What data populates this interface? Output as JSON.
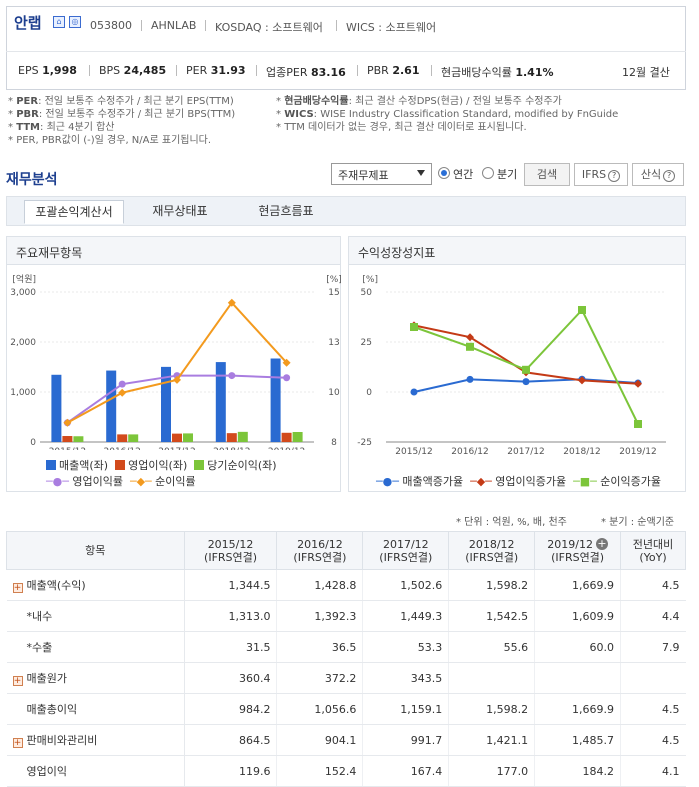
{
  "header": {
    "company_name": "안랩",
    "code": "053800",
    "english_name": "AHNLAB",
    "market": "KOSDAQ : 소프트웨어",
    "wics": "WICS : 소프트웨어",
    "stats": [
      {
        "label": "EPS",
        "value": "1,998"
      },
      {
        "label": "BPS",
        "value": "24,485"
      },
      {
        "label": "PER",
        "value": "31.93"
      },
      {
        "label": "업종PER",
        "value": "83.16"
      },
      {
        "label": "PBR",
        "value": "2.61"
      },
      {
        "label": "현금배당수익률",
        "value": "1.41%"
      }
    ],
    "fiscal": "12월 결산"
  },
  "notes": {
    "left": [
      {
        "key": "PER",
        "text": ": 전일 보통주 수정주가 / 최근 분기 EPS(TTM)"
      },
      {
        "key": "PBR",
        "text": ": 전일 보통주 수정주가 / 최근 분기 BPS(TTM)"
      },
      {
        "key": "TTM",
        "text": ": 최근 4분기 합산"
      },
      {
        "key": "",
        "text": "PER, PBR값이 (-)일 경우, N/A로 표기됩니다."
      }
    ],
    "right": [
      {
        "key": "현금배당수익률",
        "text": ": 최근 결산 수정DPS(현금) / 전일 보통주 수정주가"
      },
      {
        "key": "WICS",
        "text": ": WISE Industry Classification Standard, modified by FnGuide"
      },
      {
        "key": "",
        "text": "TTM 데이터가 없는 경우, 최근 결산 데이터로 표시됩니다."
      }
    ]
  },
  "section": {
    "title": "재무분석",
    "select_value": "주재무제표",
    "radio_annual": "연간",
    "radio_quarter": "분기",
    "search_button": "검색",
    "ifrs_button": "IFRS",
    "formula_button": "산식"
  },
  "tabs": [
    {
      "label": "포괄손익계산서",
      "active": true
    },
    {
      "label": "재무상태표",
      "active": false
    },
    {
      "label": "현금흐름표",
      "active": false
    }
  ],
  "chart_data": [
    {
      "type": "bar",
      "panel_title": "주요재무항목",
      "categories": [
        "2015/12",
        "2016/12",
        "2017/12",
        "2018/12",
        "2019/12"
      ],
      "y_left_label": "[억원]",
      "y_right_label": "[%]",
      "y_left_ticks": [
        "3,000",
        "2,000",
        "1,000",
        "0"
      ],
      "y_right_ticks": [
        "15",
        "13",
        "10",
        "8"
      ],
      "ylim_left": [
        0,
        3000
      ],
      "ylim_right": [
        8,
        15
      ],
      "series": [
        {
          "name": "매출액(좌)",
          "kind": "bar",
          "axis": "left",
          "color": "#2a6ad1",
          "values": [
            1344.5,
            1428.8,
            1502.6,
            1598.2,
            1669.9
          ]
        },
        {
          "name": "영업이익(좌)",
          "kind": "bar",
          "axis": "left",
          "color": "#d24a1c",
          "values": [
            119.6,
            152.4,
            167.4,
            177.0,
            184.2
          ]
        },
        {
          "name": "당기순이익(좌)",
          "kind": "bar",
          "axis": "left",
          "color": "#7cc53a",
          "values": [
            115.0,
            152.0,
            172.0,
            203.0,
            200.0
          ]
        },
        {
          "name": "영업이익률",
          "kind": "line",
          "axis": "right",
          "color": "#a97de0",
          "values": [
            8.9,
            10.7,
            11.1,
            11.1,
            11.0
          ]
        },
        {
          "name": "순이익률",
          "kind": "line",
          "axis": "right",
          "color": "#f39a1e",
          "values": [
            8.9,
            10.3,
            10.9,
            14.5,
            11.7
          ]
        }
      ]
    },
    {
      "type": "line",
      "panel_title": "수익성장성지표",
      "categories": [
        "2015/12",
        "2016/12",
        "2017/12",
        "2018/12",
        "2019/12"
      ],
      "y_label": "[%]",
      "y_ticks": [
        "50",
        "25",
        "0",
        "-25"
      ],
      "ylim": [
        -25,
        50
      ],
      "series": [
        {
          "name": "매출액증가율",
          "color": "#2a6ad1",
          "marker": "circle",
          "values": [
            0.0,
            6.3,
            5.2,
            6.4,
            4.5
          ]
        },
        {
          "name": "영업이익증가율",
          "color": "#c43a16",
          "marker": "diamond",
          "values": [
            33.3,
            27.4,
            9.8,
            5.8,
            4.1
          ]
        },
        {
          "name": "순이익증가율",
          "color": "#7cc53a",
          "marker": "square",
          "values": [
            32.5,
            22.6,
            11.1,
            41.0,
            -16.0
          ]
        }
      ]
    }
  ],
  "table": {
    "unit_note": "* 단위 : 억원, %, 배, 천주",
    "quarter_note": "* 분기 : 순액기준",
    "header_item": "항목",
    "columns": [
      {
        "year": "2015/12",
        "basis": "(IFRS연결)"
      },
      {
        "year": "2016/12",
        "basis": "(IFRS연결)"
      },
      {
        "year": "2017/12",
        "basis": "(IFRS연결)"
      },
      {
        "year": "2018/12",
        "basis": "(IFRS연결)"
      },
      {
        "year": "2019/12",
        "basis": "(IFRS연결)"
      }
    ],
    "yoy_header": "전년대비",
    "yoy_sub": "(YoY)",
    "rows": [
      {
        "label": "매출액(수익)",
        "expand": true,
        "values": [
          "1,344.5",
          "1,428.8",
          "1,502.6",
          "1,598.2",
          "1,669.9"
        ],
        "yoy": "4.5"
      },
      {
        "label": "*내수",
        "expand": false,
        "values": [
          "1,313.0",
          "1,392.3",
          "1,449.3",
          "1,542.5",
          "1,609.9"
        ],
        "yoy": "4.4"
      },
      {
        "label": "*수출",
        "expand": false,
        "values": [
          "31.5",
          "36.5",
          "53.3",
          "55.6",
          "60.0"
        ],
        "yoy": "7.9"
      },
      {
        "label": "매출원가",
        "expand": true,
        "values": [
          "360.4",
          "372.2",
          "343.5",
          "",
          ""
        ],
        "yoy": ""
      },
      {
        "label": "매출총이익",
        "expand": false,
        "values": [
          "984.2",
          "1,056.6",
          "1,159.1",
          "1,598.2",
          "1,669.9"
        ],
        "yoy": "4.5"
      },
      {
        "label": "판매비와관리비",
        "expand": true,
        "values": [
          "864.5",
          "904.1",
          "991.7",
          "1,421.1",
          "1,485.7"
        ],
        "yoy": "4.5"
      },
      {
        "label": "영업이익",
        "expand": false,
        "values": [
          "119.6",
          "152.4",
          "167.4",
          "177.0",
          "184.2"
        ],
        "yoy": "4.1"
      }
    ]
  }
}
